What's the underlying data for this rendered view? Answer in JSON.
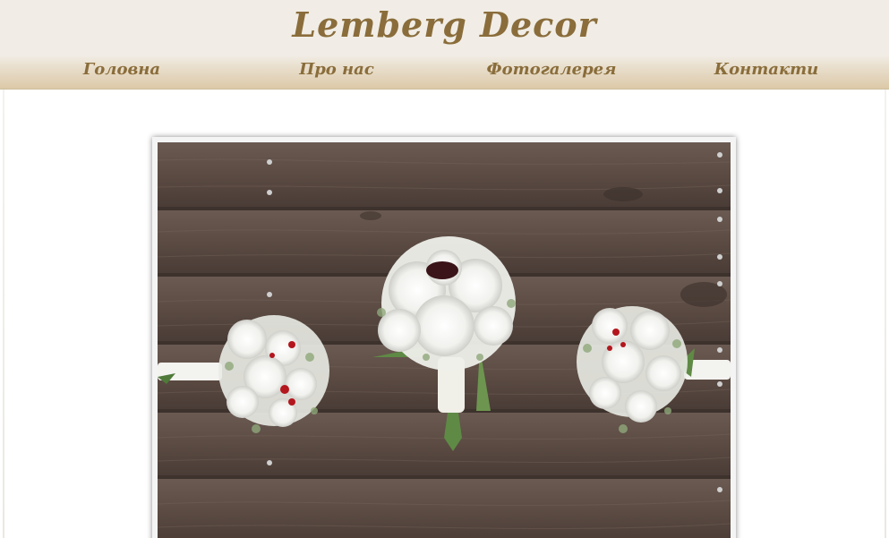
{
  "site": {
    "title": "Lemberg Decor"
  },
  "nav": {
    "items": [
      {
        "label": "Головна"
      },
      {
        "label": "Про нас"
      },
      {
        "label": "Фотогалерея"
      },
      {
        "label": "Контакти"
      }
    ]
  },
  "gallery": {
    "image_name": "bouquets-photo"
  },
  "colors": {
    "brand_text": "#8a6d3b",
    "header_bg": "#f1ede6",
    "header_band": "#dcc9a8"
  }
}
